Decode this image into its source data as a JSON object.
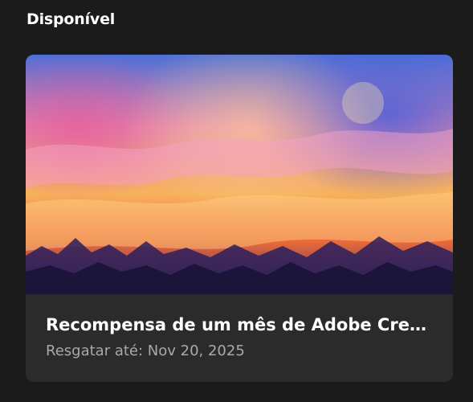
{
  "section": {
    "title": "Disponível"
  },
  "card": {
    "title": "Recompensa de um mês de Adobe Crea...",
    "subtitle": "Resgatar até: Nov 20, 2025"
  }
}
